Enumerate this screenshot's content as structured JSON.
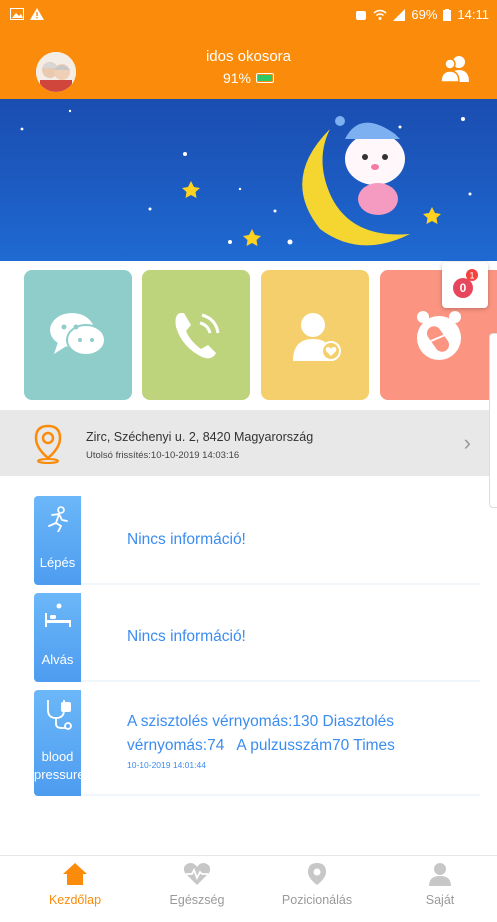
{
  "statusbar": {
    "battery": "69%",
    "time": "14:11"
  },
  "header": {
    "title": "idos okosora",
    "battery_percent": "91%"
  },
  "tiles": [
    {
      "name": "chat",
      "icon": "chat-bubbles-icon"
    },
    {
      "name": "call",
      "icon": "phone-call-icon"
    },
    {
      "name": "contacts",
      "icon": "contact-heart-icon"
    },
    {
      "name": "alarm",
      "icon": "alarm-pill-icon"
    }
  ],
  "badge": {
    "value": "0",
    "dot": "1"
  },
  "location": {
    "address": "Zirc, Széchenyi u. 2, 8420 Magyarország",
    "updated": "Utolsó frissítés:10-10-2019 14:03:16"
  },
  "health": [
    {
      "label": "Lépés",
      "text": "Nincs információ!"
    },
    {
      "label": "Alvás",
      "text": "Nincs információ!"
    },
    {
      "label_line1": "blood",
      "label_line2": "pressure",
      "text_line1": "A szisztolés vérnyomás:130 Diasztolés",
      "text_line2": "vérnyomás:74   A pulzusszám70 Times",
      "date": "10-10-2019 14:01:44"
    }
  ],
  "nav": [
    {
      "label": "Kezdőlap",
      "active": true
    },
    {
      "label": "Egészség",
      "active": false
    },
    {
      "label": "Pozicionálás",
      "active": false
    },
    {
      "label": "Saját",
      "active": false
    }
  ],
  "colors": {
    "accent": "#fb8c0b",
    "link": "#3b8cf0",
    "banner": "#1c5dc4"
  }
}
